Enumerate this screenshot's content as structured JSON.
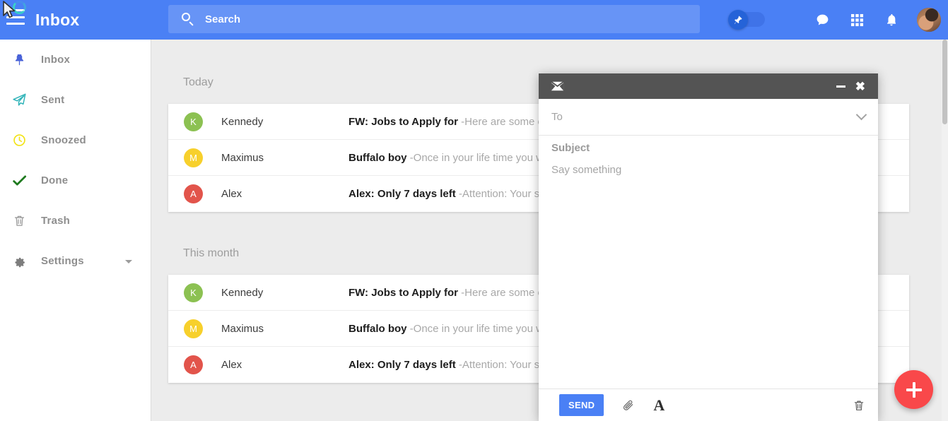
{
  "header": {
    "menu_icon": "hamburger-icon",
    "title": "Inbox",
    "search": {
      "icon": "search-icon",
      "placeholder": "Search",
      "value": ""
    },
    "pin_toggle": {
      "icon": "pin-icon",
      "state": "on"
    },
    "icons": [
      {
        "name": "chat-icon",
        "glyph": "comment"
      },
      {
        "name": "apps-grid-icon",
        "glyph": "grid"
      },
      {
        "name": "notifications-bell-icon",
        "glyph": "bell"
      }
    ],
    "avatar": {
      "name": "user-avatar",
      "alt": "User profile photo"
    },
    "cursor": {
      "name": "mouse-cursor",
      "spinner": "loading-spinner"
    }
  },
  "sidebar": {
    "items": [
      {
        "label": "Inbox",
        "icon": "pin-icon",
        "color": "#4a63d8",
        "has_caret": false
      },
      {
        "label": "Sent",
        "icon": "paper-plane-icon",
        "color": "#2fb3b8",
        "has_caret": false
      },
      {
        "label": "Snoozed",
        "icon": "clock-icon",
        "color": "#f2e316",
        "has_caret": false
      },
      {
        "label": "Done",
        "icon": "check-icon",
        "color": "#1f7a1f",
        "has_caret": false
      },
      {
        "label": "Trash",
        "icon": "trash-icon",
        "color": "#9a9a9a",
        "has_caret": false
      },
      {
        "label": "Settings",
        "icon": "gear-icon",
        "color": "#7d7d7d",
        "has_caret": true
      }
    ]
  },
  "main": {
    "groups": [
      {
        "label": "Today",
        "emails": [
          {
            "initial": "K",
            "avatar_color": "#8cc152",
            "sender": "Kennedy",
            "subject": "FW: Jobs to Apply for",
            "preview": "-Here are some of"
          },
          {
            "initial": "M",
            "avatar_color": "#f7d02c",
            "sender": "Maximus",
            "subject": "Buffalo boy",
            "preview": "-Once in your life time you wi"
          },
          {
            "initial": "A",
            "avatar_color": "#e2544b",
            "sender": "Alex",
            "subject": "Alex: Only 7 days left",
            "preview": "-Attention: Your sul"
          }
        ]
      },
      {
        "label": "This month",
        "emails": [
          {
            "initial": "K",
            "avatar_color": "#8cc152",
            "sender": "Kennedy",
            "subject": "FW: Jobs to Apply for",
            "preview": "-Here are some of"
          },
          {
            "initial": "M",
            "avatar_color": "#f7d02c",
            "sender": "Maximus",
            "subject": "Buffalo boy",
            "preview": "-Once in your life time you wi"
          },
          {
            "initial": "A",
            "avatar_color": "#e2544b",
            "sender": "Alex",
            "subject": "Alex: Only 7 days left",
            "preview": "-Attention: Your sul"
          }
        ]
      }
    ],
    "fab": {
      "name": "compose-fab",
      "icon": "plus-icon",
      "color": "#f9484a"
    }
  },
  "compose": {
    "window_icon": "envelope-icon",
    "minimize_icon": "minimize-icon",
    "close_icon": "close-icon",
    "to": {
      "placeholder": "To",
      "value": ""
    },
    "expand_icon": "chevron-down-icon",
    "subject": {
      "placeholder": "Subject",
      "value": ""
    },
    "body": {
      "placeholder": "Say something",
      "value": ""
    },
    "send_label": "SEND",
    "attach_icon": "paperclip-icon",
    "format_icon": "text-format-icon",
    "discard_icon": "trash-icon"
  },
  "colors": {
    "brand_blue": "#4a80f5",
    "compose_header": "#545454",
    "canvas": "#ececec",
    "fab_red": "#f9484a"
  }
}
